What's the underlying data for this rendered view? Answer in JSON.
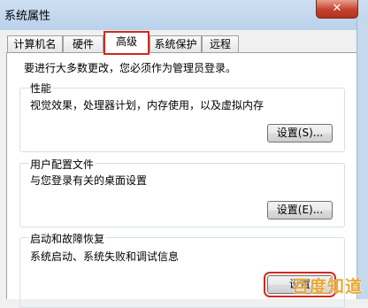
{
  "window": {
    "title": "系统属性",
    "close_label": "✕"
  },
  "tabs": [
    {
      "label": "计算机名"
    },
    {
      "label": "硬件"
    },
    {
      "label": "高级"
    },
    {
      "label": "系统保护"
    },
    {
      "label": "远程"
    }
  ],
  "intro": "要进行大多数更改，您必须作为管理员登录。",
  "groups": {
    "performance": {
      "title": "性能",
      "desc": "视觉效果，处理器计划，内存使用，以及虚拟内存",
      "button": "设置(S)..."
    },
    "user_profiles": {
      "title": "用户配置文件",
      "desc": "与您登录有关的桌面设置",
      "button": "设置(E)..."
    },
    "startup_recovery": {
      "title": "启动和故障恢复",
      "desc": "系统启动、系统失败和调试信息",
      "button": "设置"
    }
  },
  "watermark": "百度知道"
}
